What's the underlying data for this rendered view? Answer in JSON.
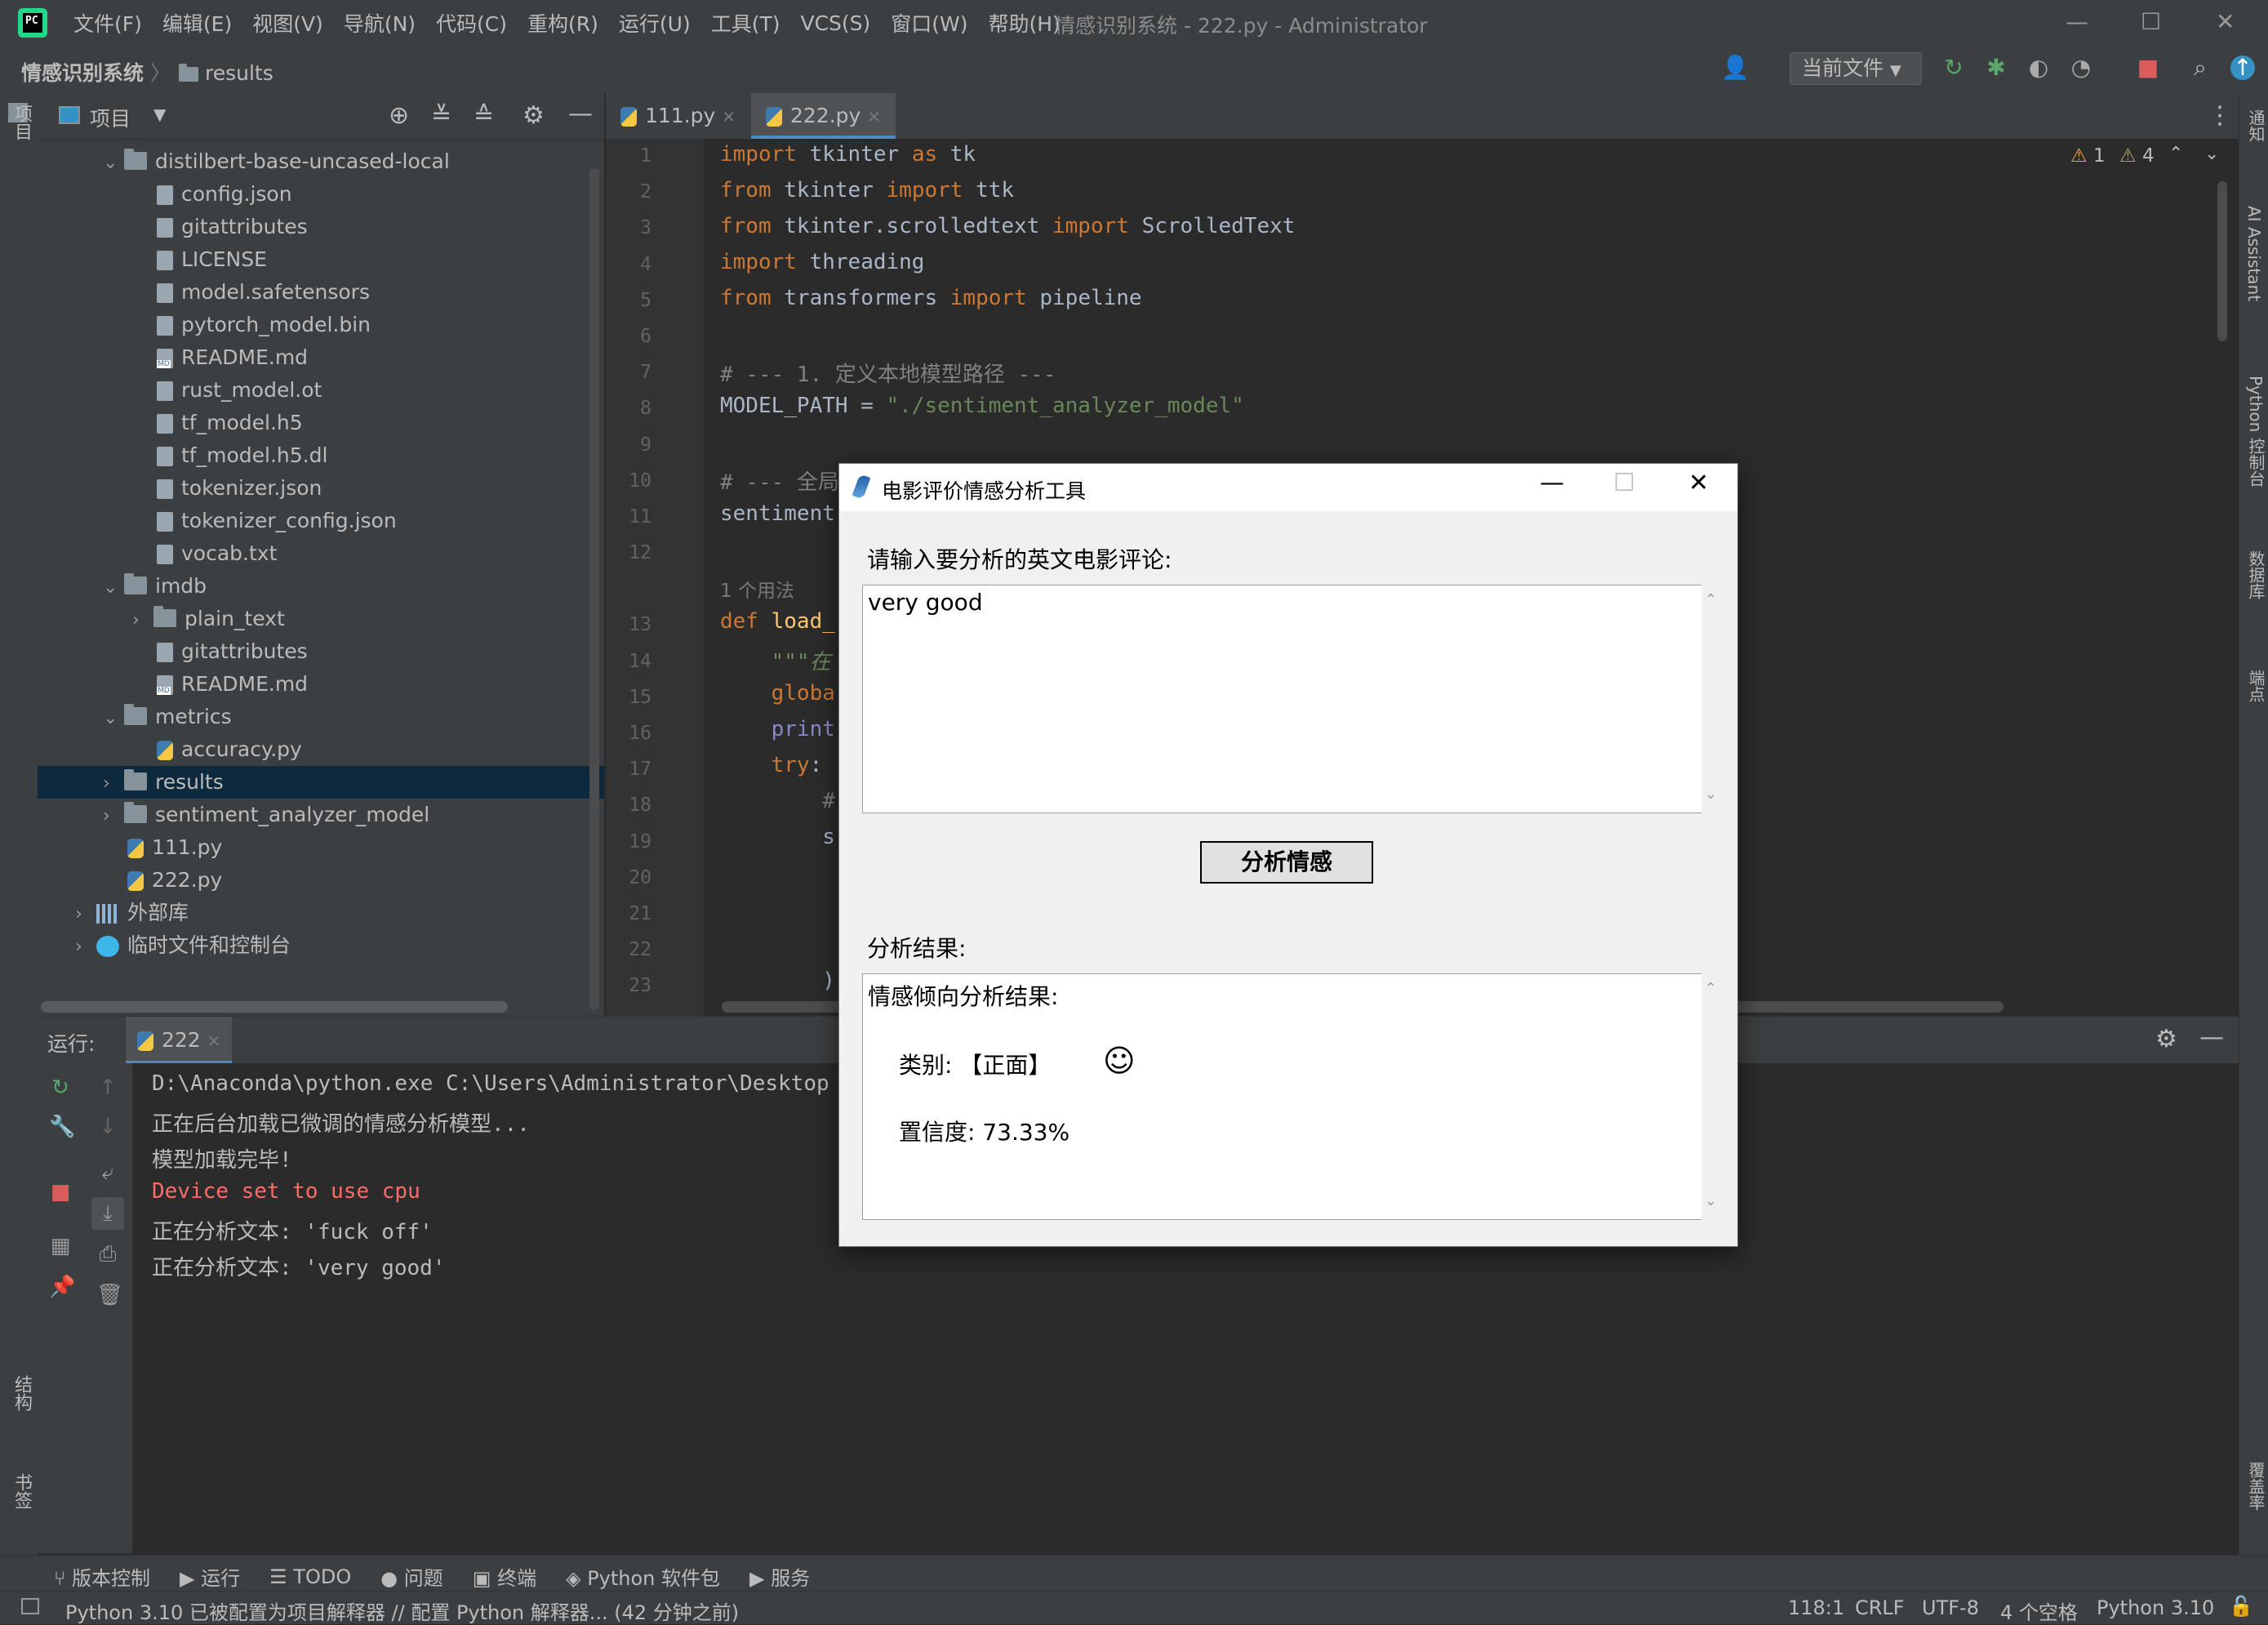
{
  "menubar": {
    "items": [
      "文件(F)",
      "编辑(E)",
      "视图(V)",
      "导航(N)",
      "代码(C)",
      "重构(R)",
      "运行(U)",
      "工具(T)",
      "VCS(S)",
      "窗口(W)",
      "帮助(H)"
    ],
    "window_title": "情感识别系统 - 222.py - Administrator"
  },
  "navbar": {
    "project": "情感识别系统",
    "folder": "results",
    "run_config": "当前文件"
  },
  "project_panel": {
    "title": "项目",
    "tree": [
      {
        "label": "distilbert-base-uncased-local",
        "type": "folder",
        "depth": 1,
        "expanded": true
      },
      {
        "label": "config.json",
        "type": "file",
        "depth": 2
      },
      {
        "label": "gitattributes",
        "type": "file",
        "depth": 2
      },
      {
        "label": "LICENSE",
        "type": "file",
        "depth": 2
      },
      {
        "label": "model.safetensors",
        "type": "file",
        "depth": 2
      },
      {
        "label": "pytorch_model.bin",
        "type": "file",
        "depth": 2
      },
      {
        "label": "README.md",
        "type": "md",
        "depth": 2
      },
      {
        "label": "rust_model.ot",
        "type": "file",
        "depth": 2
      },
      {
        "label": "tf_model.h5",
        "type": "file",
        "depth": 2
      },
      {
        "label": "tf_model.h5.dl",
        "type": "file",
        "depth": 2
      },
      {
        "label": "tokenizer.json",
        "type": "file",
        "depth": 2
      },
      {
        "label": "tokenizer_config.json",
        "type": "file",
        "depth": 2
      },
      {
        "label": "vocab.txt",
        "type": "file",
        "depth": 2
      },
      {
        "label": "imdb",
        "type": "folder",
        "depth": 1,
        "expanded": true
      },
      {
        "label": "plain_text",
        "type": "folder",
        "depth": 2,
        "expanded": false
      },
      {
        "label": "gitattributes",
        "type": "file",
        "depth": 2
      },
      {
        "label": "README.md",
        "type": "md",
        "depth": 2
      },
      {
        "label": "metrics",
        "type": "folder",
        "depth": 1,
        "expanded": true
      },
      {
        "label": "accuracy.py",
        "type": "py",
        "depth": 2
      },
      {
        "label": "results",
        "type": "folder",
        "depth": 1,
        "expanded": false,
        "selected": true
      },
      {
        "label": "sentiment_analyzer_model",
        "type": "folder",
        "depth": 1,
        "expanded": false
      },
      {
        "label": "111.py",
        "type": "py",
        "depth": 1
      },
      {
        "label": "222.py",
        "type": "py",
        "depth": 1
      },
      {
        "label": "外部库",
        "type": "lib",
        "depth": 0,
        "expanded": false
      },
      {
        "label": "临时文件和控制台",
        "type": "scratch",
        "depth": 0,
        "expanded": false
      }
    ]
  },
  "editor": {
    "tabs": [
      {
        "label": "111.py",
        "active": false
      },
      {
        "label": "222.py",
        "active": true
      }
    ],
    "warnings": {
      "errors": "1",
      "warns": "4"
    },
    "line_numbers": [
      "1",
      "2",
      "3",
      "4",
      "5",
      "6",
      "7",
      "8",
      "9",
      "10",
      "11",
      "12",
      "13",
      "14",
      "15",
      "16",
      "17",
      "18",
      "19",
      "20",
      "21",
      "22",
      "23"
    ],
    "usage_hint": "1 个用法"
  },
  "run_panel": {
    "label": "运行:",
    "tab": "222",
    "lines": [
      {
        "text": "D:\\Anaconda\\python.exe C:\\Users\\Administrator\\Desktop",
        "error": false
      },
      {
        "text": "正在后台加载已微调的情感分析模型...",
        "error": false
      },
      {
        "text": "模型加载完毕!",
        "error": false
      },
      {
        "text": "Device set to use cpu",
        "error": true
      },
      {
        "text": "正在分析文本: 'fuck off'",
        "error": false
      },
      {
        "text": "正在分析文本: 'very good'",
        "error": false
      }
    ]
  },
  "bottom_tools": [
    "版本控制",
    "运行",
    "TODO",
    "问题",
    "终端",
    "Python 软件包",
    "服务"
  ],
  "statusbar": {
    "message": "Python 3.10 已被配置为项目解释器 // 配置 Python 解释器... (42 分钟之前)",
    "position": "118:1",
    "line_sep": "CRLF",
    "encoding": "UTF-8",
    "indent": "4 个空格",
    "interpreter": "Python 3.10"
  },
  "left_stripe": {
    "project": "项目",
    "structure": "结构",
    "bookmarks": "书签"
  },
  "right_stripe": {
    "notifications": "通知",
    "ai": "AI Assistant",
    "python_console": "Python 控制台",
    "database": "数据库",
    "endpoints": "端点",
    "coverage": "覆盖率"
  },
  "dialog": {
    "title": "电影评价情感分析工具",
    "input_label": "请输入要分析的英文电影评论:",
    "input_value": "very good",
    "analyze_button": "分析情感",
    "result_label": "分析结果:",
    "result_heading": "情感倾向分析结果:",
    "result_category": "类别: 【正面】",
    "result_emoji": "☺",
    "result_confidence": "置信度: 73.33%"
  }
}
